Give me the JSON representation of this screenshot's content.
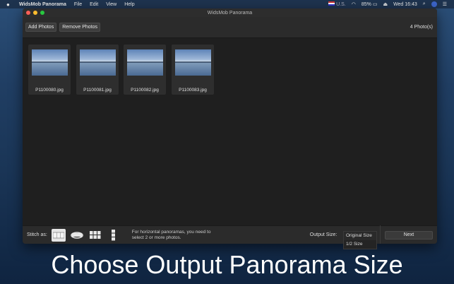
{
  "menubar": {
    "app_name": "WidsMob Panorama",
    "menus": [
      "File",
      "Edit",
      "View",
      "Help"
    ],
    "locale": "U.S.",
    "battery": "85%",
    "clock": "Wed 16:43"
  },
  "window": {
    "title": "WidsMob Panorama"
  },
  "toolbar": {
    "add_photos_label": "Add Photos",
    "remove_photos_label": "Remove Photos",
    "photo_count": "4 Photo(s)"
  },
  "photos": [
    {
      "name": "P1100080.jpg"
    },
    {
      "name": "P1100081.jpg"
    },
    {
      "name": "P1100082.jpg"
    },
    {
      "name": "P1100083.jpg"
    }
  ],
  "bottom": {
    "stitch_label": "Stitch as:",
    "hint_line1": "For horizontal panoramas, you need to",
    "hint_line2": "select 2 or more photos.",
    "output_size_label": "Output Size:",
    "output_options": [
      "Original Size",
      "1/2 Size"
    ],
    "selected_output": "Original Size",
    "next_label": "Next",
    "stitch_modes": [
      "horizontal-icon",
      "360-icon",
      "grid-icon",
      "vertical-icon"
    ]
  },
  "caption": "Choose Output Panorama Size"
}
